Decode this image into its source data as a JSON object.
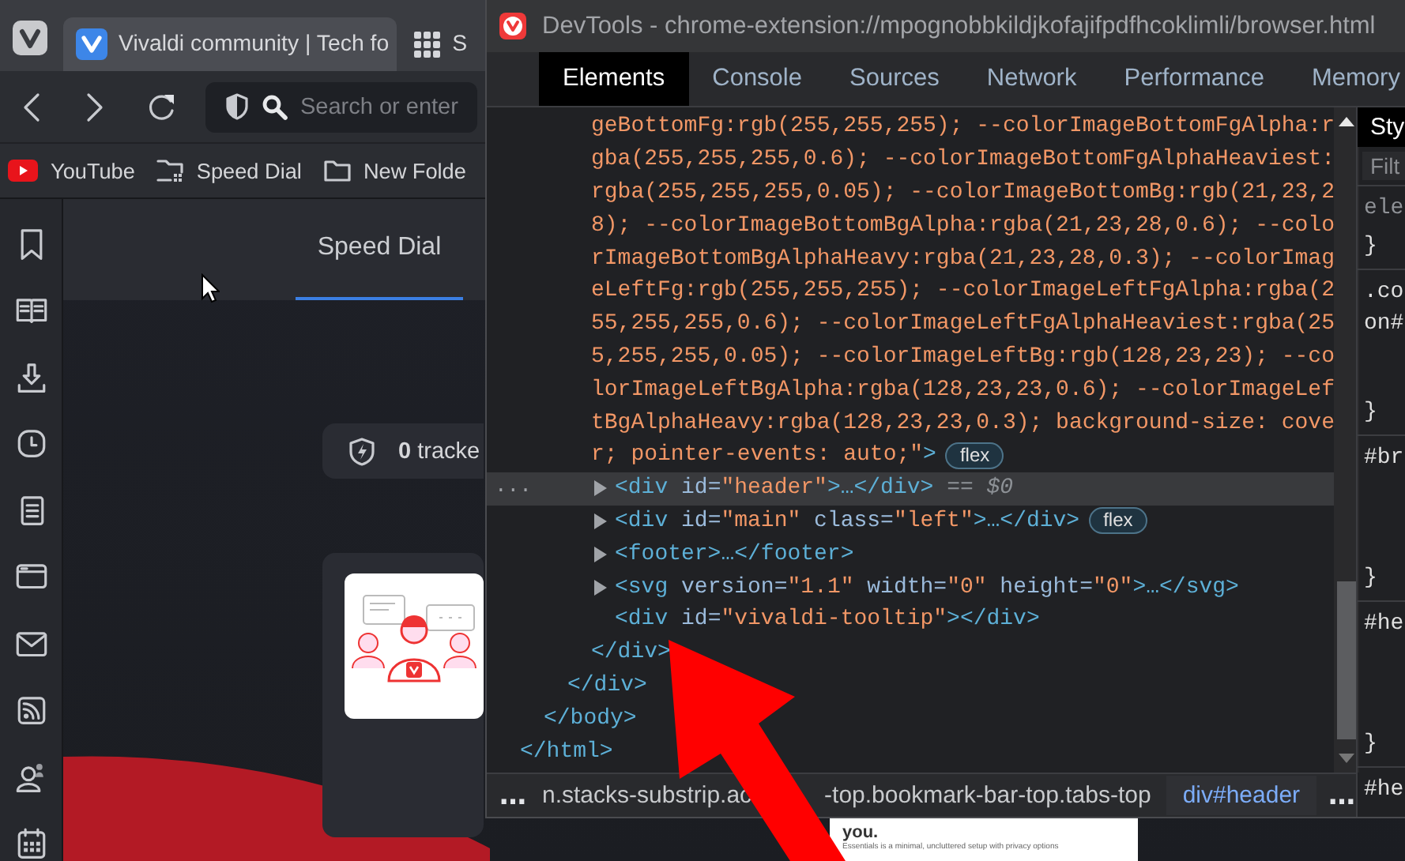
{
  "browser": {
    "tabs": [
      {
        "kind": "page",
        "title": "Vivaldi community | Tech fo",
        "selected": true
      },
      {
        "kind": "tile",
        "title": "S",
        "selected": false
      }
    ],
    "address": {
      "placeholder": "Search or enter"
    },
    "bookmarks": [
      {
        "kind": "youtube",
        "label": "YouTube"
      },
      {
        "kind": "speed-dial",
        "label": "Speed Dial"
      },
      {
        "kind": "folder",
        "label": "New Folde"
      }
    ],
    "page_tabs": [
      {
        "label": "Speed Dial",
        "selected": true
      }
    ],
    "tracker": "**0** tracke",
    "behind_page": {
      "heading": "you.",
      "text": "Essentials is a minimal, uncluttered setup with privacy options"
    }
  },
  "devtools": {
    "title": "DevTools - chrome-extension://mpognobbkildjkofajifpdfhcoklimli/browser.html",
    "tabs": [
      {
        "label": "Elements",
        "selected": true
      },
      {
        "label": "Console",
        "selected": false
      },
      {
        "label": "Sources",
        "selected": false
      },
      {
        "label": "Network",
        "selected": false
      },
      {
        "label": "Performance",
        "selected": false
      },
      {
        "label": "Memory",
        "selected": false
      }
    ],
    "tree": {
      "closing": [
        {
          "kind": "tag",
          "text": "</html>"
        }
      ],
      "children": [
        {
          "closing": [
            {
              "kind": "tag",
              "text": "</body>"
            }
          ],
          "children": [
            {
              "closing": [
                {
                  "kind": "tag",
                  "text": "</div>"
                }
              ],
              "children": [
                {
                  "badge": "flex",
                  "lines": [
                    [
                      {
                        "kind": "value",
                        "text": "geBottomFg:rgb(255,255,255); --colorImageBottomFgAlpha:r"
                      }
                    ],
                    [
                      {
                        "kind": "value",
                        "text": "gba(255,255,255,0.6); --colorImageBottomFgAlphaHeaviest:"
                      }
                    ],
                    [
                      {
                        "kind": "value",
                        "text": "rgba(255,255,255,0.05); --colorImageBottomBg:rgb(21,23,2"
                      }
                    ],
                    [
                      {
                        "kind": "value",
                        "text": "8); --colorImageBottomBgAlpha:rgba(21,23,28,0.6); --colo"
                      }
                    ],
                    [
                      {
                        "kind": "value",
                        "text": "rImageBottomBgAlphaHeavy:rgba(21,23,28,0.3); --colorImag"
                      }
                    ],
                    [
                      {
                        "kind": "value",
                        "text": "eLeftFg:rgb(255,255,255); --colorImageLeftFgAlpha:rgba(2"
                      }
                    ],
                    [
                      {
                        "kind": "value",
                        "text": "55,255,255,0.6); --colorImageLeftFgAlphaHeaviest:rgba(25"
                      }
                    ],
                    [
                      {
                        "kind": "value",
                        "text": "5,255,255,0.05); --colorImageLeftBg:rgb(128,23,23); --co"
                      }
                    ],
                    [
                      {
                        "kind": "value",
                        "text": "lorImageLeftBgAlpha:rgba(128,23,23,0.6); --colorImageLef"
                      }
                    ],
                    [
                      {
                        "kind": "value",
                        "text": "tBgAlphaHeavy:rgba(128,23,23,0.3); background-size: cove"
                      }
                    ],
                    [
                      {
                        "kind": "value",
                        "text": "r; pointer-events: auto;\""
                      },
                      {
                        "kind": "tag",
                        "text": ">"
                      }
                    ]
                  ],
                  "closing": [
                    {
                      "kind": "tag",
                      "text": "</div>"
                    }
                  ],
                  "children": [
                    {
                      "expandable": true,
                      "selected": true,
                      "menu": "...",
                      "ref": "== $0",
                      "tokens": [
                        {
                          "kind": "tag",
                          "text": "<div"
                        },
                        {
                          "kind": "attr",
                          "text": " id="
                        },
                        {
                          "kind": "value",
                          "text": "\"header\""
                        },
                        {
                          "kind": "tag",
                          "text": ">…</div>"
                        }
                      ]
                    },
                    {
                      "expandable": true,
                      "selected": false,
                      "badge": "flex",
                      "tokens": [
                        {
                          "kind": "tag",
                          "text": "<div"
                        },
                        {
                          "kind": "attr",
                          "text": " id="
                        },
                        {
                          "kind": "value",
                          "text": "\"main\""
                        },
                        {
                          "kind": "attr",
                          "text": " class="
                        },
                        {
                          "kind": "value",
                          "text": "\"left\""
                        },
                        {
                          "kind": "tag",
                          "text": ">…</div>"
                        }
                      ]
                    },
                    {
                      "expandable": true,
                      "selected": false,
                      "tokens": [
                        {
                          "kind": "tag",
                          "text": "<footer>…</footer>"
                        }
                      ]
                    },
                    {
                      "expandable": true,
                      "selected": false,
                      "tokens": [
                        {
                          "kind": "tag",
                          "text": "<svg"
                        },
                        {
                          "kind": "attr",
                          "text": " version="
                        },
                        {
                          "kind": "value",
                          "text": "\"1.1\""
                        },
                        {
                          "kind": "attr",
                          "text": " width="
                        },
                        {
                          "kind": "value",
                          "text": "\"0\""
                        },
                        {
                          "kind": "attr",
                          "text": " height="
                        },
                        {
                          "kind": "value",
                          "text": "\"0\""
                        },
                        {
                          "kind": "tag",
                          "text": ">…</svg>"
                        }
                      ]
                    },
                    {
                      "selected": false,
                      "tokens": [
                        {
                          "kind": "tag",
                          "text": "<div"
                        },
                        {
                          "kind": "attr",
                          "text": " id="
                        },
                        {
                          "kind": "value",
                          "text": "\"vivaldi-tooltip\""
                        },
                        {
                          "kind": "tag",
                          "text": "></div>"
                        }
                      ]
                    }
                  ]
                }
              ]
            }
          ]
        }
      ]
    },
    "breadcrumbs": {
      "more_left": "…",
      "more_right": "…",
      "items": [
        {
          "text": "n.stacks-substrip.ac",
          "selected": false
        },
        {
          "text": "-top.bookmark-bar-top.tabs-top",
          "selected": false
        },
        {
          "text": "div#header",
          "selected": true
        }
      ]
    },
    "styles": {
      "tab": "Sty",
      "filter_placeholder": "Filt",
      "rules": [
        {
          "kind": "element",
          "lines": [
            "ele"
          ],
          "closing": "}"
        },
        {
          "kind": "rule",
          "lines": [
            ".co",
            "on#"
          ],
          "closing": "}"
        },
        {
          "kind": "rule",
          "lines": [
            "#br"
          ],
          "closing": "}"
        },
        {
          "kind": "rule",
          "lines": [
            "#he"
          ],
          "closing": "}"
        },
        {
          "kind": "rule",
          "lines": [
            "#he"
          ]
        }
      ]
    }
  }
}
